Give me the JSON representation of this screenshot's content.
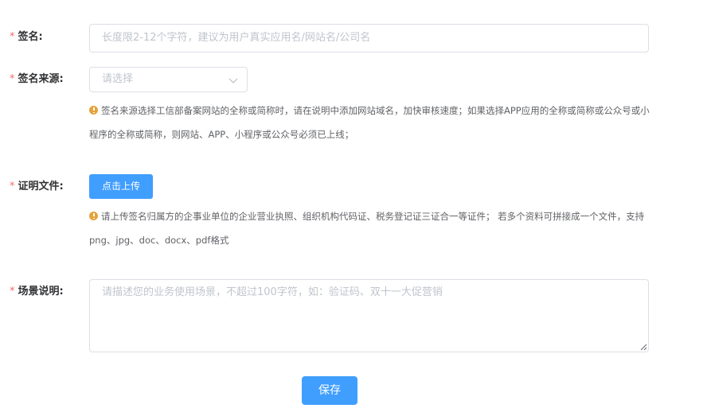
{
  "required_mark": "*",
  "fields": {
    "signature": {
      "label": "签名:",
      "placeholder": "长度限2-12个字符，建议为用户真实应用名/网站名/公司名"
    },
    "source": {
      "label": "签名来源:",
      "placeholder": "请选择",
      "icon": "chevron-down-icon",
      "tip": "签名来源选择工信部备案网站的全称或简称时，请在说明中添加网站域名，加快审核速度；如果选择APP应用的全称或简称或公众号或小程序的全称或简称，则网站、APP、小程序或公众号必须已上线；"
    },
    "proof": {
      "label": "证明文件:",
      "upload_label": "点击上传",
      "tip": "请上传签名归属方的企事业单位的企业营业执照、组织机构代码证、税务登记证三证合一等证件； 若多个资料可拼接成一个文件，支持png、jpg、doc、docx、pdf格式"
    },
    "scene": {
      "label": "场景说明:",
      "placeholder": "请描述您的业务使用场景，不超过100字符，如：验证码、双十一大促营销"
    }
  },
  "save_label": "保存",
  "colors": {
    "primary": "#409eff",
    "required": "#f56c6c",
    "warning_icon": "#e6a23c",
    "border": "#dcdfe6",
    "placeholder": "#c0c4cc"
  }
}
